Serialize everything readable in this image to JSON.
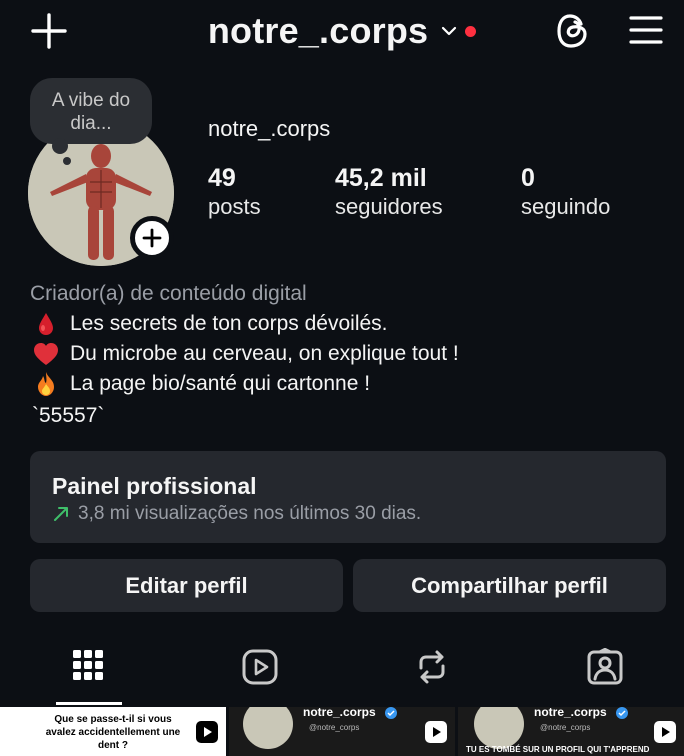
{
  "header": {
    "username": "notre_.corps",
    "icons": {
      "create": "plus-icon",
      "switch": "chevron-down-icon",
      "threads": "threads-icon",
      "menu": "hamburger-menu-icon"
    }
  },
  "profile": {
    "note": "A vibe do dia...",
    "display_username": "notre_.corps",
    "stats": [
      {
        "value": "49",
        "label": "posts"
      },
      {
        "value": "45,2 mil",
        "label": "seguidores"
      },
      {
        "value": "0",
        "label": "seguindo"
      }
    ]
  },
  "bio": {
    "category": "Criador(a) de conteúdo digital",
    "lines": [
      {
        "emoji": "drop-of-blood-icon",
        "text": "Les secrets de ton corps dévoilés."
      },
      {
        "emoji": "red-heart-icon",
        "text": "Du microbe au cerveau, on explique tout !"
      },
      {
        "emoji": "fire-icon",
        "text": "La page bio/santé qui cartonne !"
      }
    ],
    "code": "`55557`"
  },
  "dashboard": {
    "title": "Painel profissional",
    "subtitle": "3,8 mi visualizações nos últimos 30 dias."
  },
  "buttons": {
    "edit": "Editar perfil",
    "share": "Compartilhar perfil"
  },
  "tabs": [
    "grid-icon",
    "reels-icon",
    "reposts-icon",
    "tagged-icon"
  ],
  "grid": [
    {
      "caption": "Que se passe-t-il si vous avalez accidentellement une dent ?"
    },
    {
      "account": "notre_.corps",
      "handle": "@notre_corps"
    },
    {
      "account": "notre_.corps",
      "handle": "@notre_corps",
      "caption": "TU ES TOMBÉ SUR UN PROFIL QUI T'APPREND"
    }
  ],
  "colors": {
    "background": "#0c0f14",
    "card": "#25282e",
    "accent_red": "#ff3040",
    "trend_green": "#3fbf6a",
    "verified_blue": "#3897f0"
  }
}
